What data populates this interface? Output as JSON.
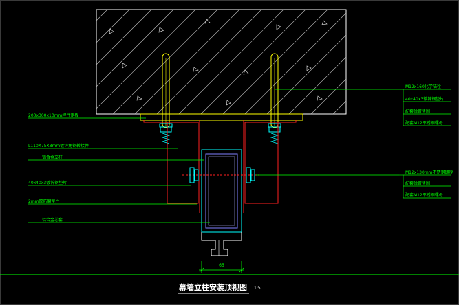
{
  "drawing": {
    "title": "幕墙立柱安装顶视图",
    "scale": "1:5",
    "dimension": "65",
    "labels_left": [
      "200x300x10mm埋件钢板",
      "L110X75X8mm镀锌角钢转接件",
      "铝合金立柱",
      "40x40x3镀锌钢垫片",
      "2mm厚防腐垫片",
      "铝合金芯套"
    ],
    "labels_right": [
      "M12x160化学锚栓",
      "40x40x3镀锌钢垫片",
      "配套弹簧垫圈",
      "配套M12不锈钢螺母",
      "M12x130mm不锈钢螺栓",
      "配套弹簧垫圈",
      "配套M12不锈钢螺母"
    ]
  },
  "colors": {
    "background": "#000000",
    "leader": "#00ff00",
    "concrete": "#ffffff",
    "plate": "#ffff00",
    "angle": "#ff2020",
    "column": "#00ffff",
    "bolt": "#00ffff"
  }
}
